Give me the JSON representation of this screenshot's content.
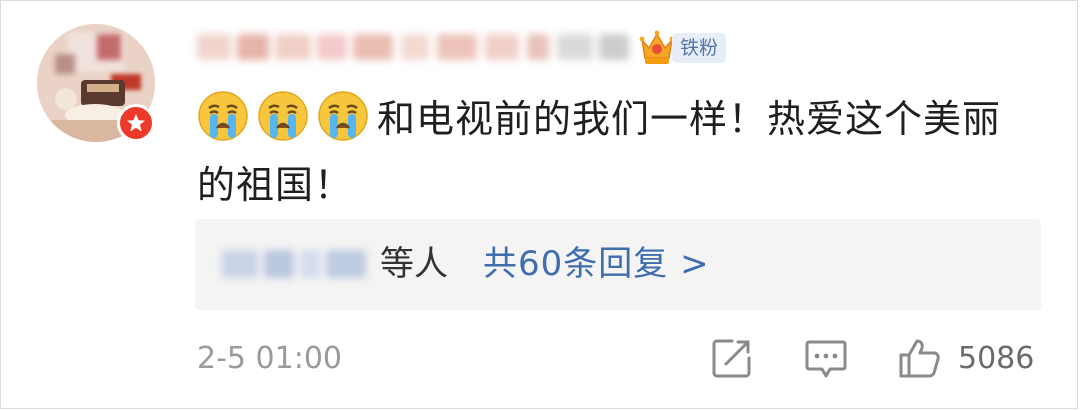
{
  "comment": {
    "author_badge": "铁粉",
    "emoji": [
      "crying-face",
      "crying-face",
      "crying-face"
    ],
    "text": "和电视前的我们一样！热爱这个美丽的祖国！",
    "timestamp": "2-5 01:00"
  },
  "replies": {
    "suffix": "等人",
    "link_label": "共60条回复 >"
  },
  "actions": {
    "share_icon": "share-icon",
    "comment_icon": "comment-icon",
    "like_icon": "thumbs-up-icon",
    "like_count": "5086"
  },
  "colors": {
    "accent_link": "#3f6dae",
    "badge_bg": "#e8eef8",
    "badge_text": "#5475a7",
    "avatar_badge": "#ee3a2b"
  }
}
